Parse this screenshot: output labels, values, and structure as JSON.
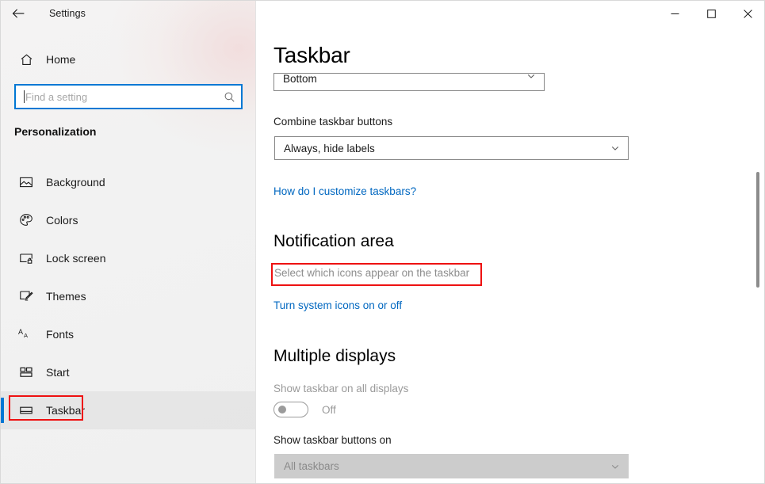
{
  "window": {
    "app_title": "Settings",
    "back_icon": "back-arrow-icon",
    "controls": {
      "minimize": "minimize-icon",
      "maximize": "maximize-icon",
      "close": "close-icon"
    }
  },
  "sidebar": {
    "home": {
      "label": "Home",
      "icon": "home-icon"
    },
    "search": {
      "placeholder": "Find a setting",
      "value": "",
      "icon": "search-icon"
    },
    "category": "Personalization",
    "items": [
      {
        "label": "Background",
        "icon": "picture-icon",
        "selected": false
      },
      {
        "label": "Colors",
        "icon": "palette-icon",
        "selected": false
      },
      {
        "label": "Lock screen",
        "icon": "lock-screen-icon",
        "selected": false
      },
      {
        "label": "Themes",
        "icon": "themes-icon",
        "selected": false
      },
      {
        "label": "Fonts",
        "icon": "fonts-icon",
        "selected": false
      },
      {
        "label": "Start",
        "icon": "start-icon",
        "selected": false
      },
      {
        "label": "Taskbar",
        "icon": "taskbar-icon",
        "selected": true
      }
    ]
  },
  "main": {
    "page_title": "Taskbar",
    "taskbar_location": {
      "value": "Bottom",
      "chevron": "chevron-down-icon"
    },
    "combine_buttons": {
      "label": "Combine taskbar buttons",
      "value": "Always, hide labels",
      "chevron": "chevron-down-icon"
    },
    "customize_link": "How do I customize taskbars?",
    "notification_area": {
      "heading": "Notification area",
      "select_icons_link": "Select which icons appear on the taskbar",
      "system_icons_link": "Turn system icons on or off"
    },
    "multiple_displays": {
      "heading": "Multiple displays",
      "show_all_displays_label": "Show taskbar on all displays",
      "toggle_state": "Off",
      "show_buttons_label": "Show taskbar buttons on",
      "show_buttons_value": "All taskbars",
      "chevron": "chevron-down-icon"
    }
  },
  "colors": {
    "accent": "#0078d4",
    "link": "#0067c0",
    "annotation": "#ee1111",
    "disabled_text": "#9a9a9a",
    "disabled_fill": "#cccccc"
  }
}
